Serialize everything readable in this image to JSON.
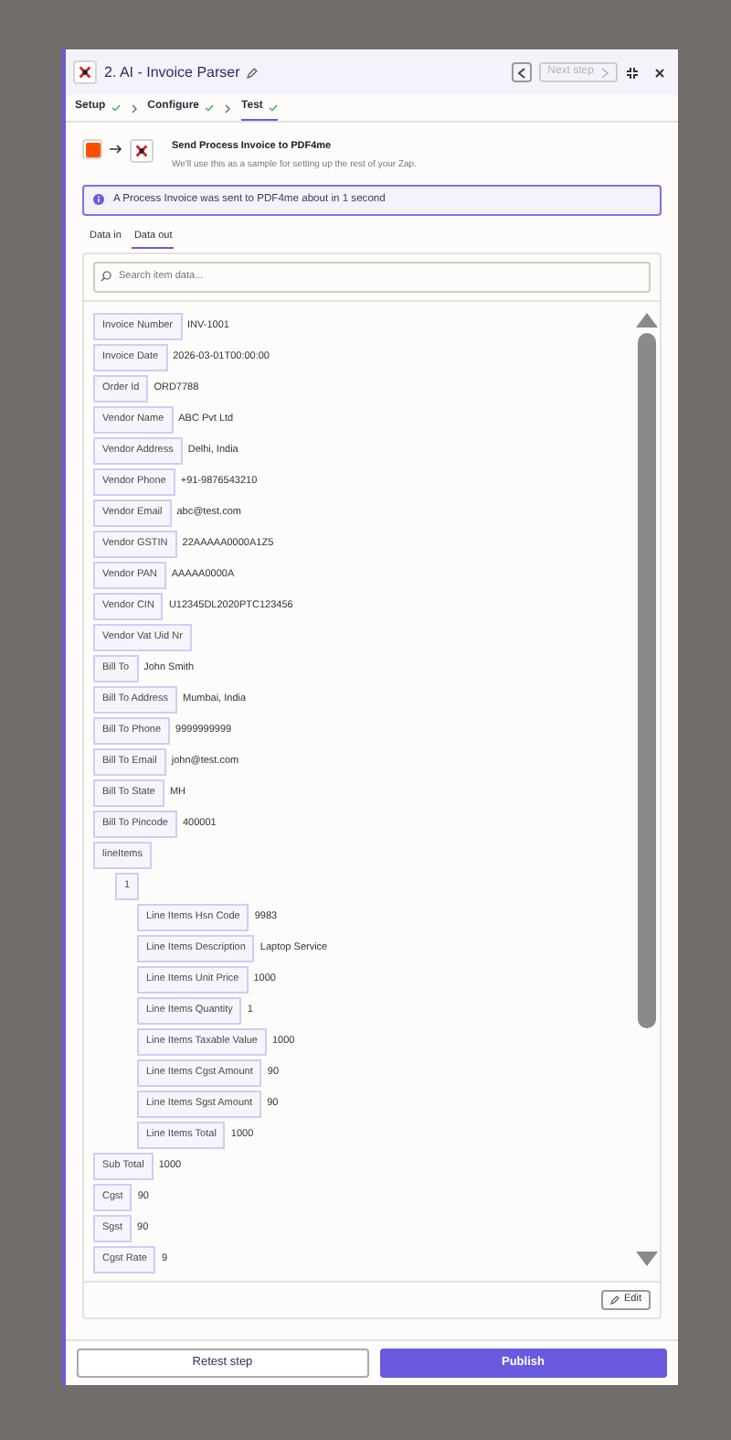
{
  "header": {
    "step_number": "2.",
    "title": "AI - Invoice Parser",
    "next_step": {
      "label": "Next step",
      "disabled": true
    }
  },
  "steps": [
    {
      "label": "Setup",
      "done": true,
      "selected": false
    },
    {
      "label": "Configure",
      "done": true,
      "selected": false
    },
    {
      "label": "Test",
      "done": true,
      "selected": true
    }
  ],
  "source": {
    "title": "Send Process Invoice to PDF4me",
    "subtitle": "We'll use this as a sample for setting up the rest of your Zap."
  },
  "info_banner": "A Process Invoice was sent to PDF4me about in 1 second",
  "data_tabs": [
    {
      "label": "Data in",
      "selected": false
    },
    {
      "label": "Data out",
      "selected": true
    }
  ],
  "search": {
    "placeholder": "Search item data..."
  },
  "fields": [
    {
      "label": "Invoice Number",
      "value": "INV-1001"
    },
    {
      "label": "Invoice Date",
      "value": "2026-03-01T00:00:00"
    },
    {
      "label": "Order Id",
      "value": "ORD7788"
    },
    {
      "label": "Vendor Name",
      "value": "ABC Pvt Ltd"
    },
    {
      "label": "Vendor Address",
      "value": "Delhi, India"
    },
    {
      "label": "Vendor Phone",
      "value": "+91-9876543210"
    },
    {
      "label": "Vendor Email",
      "value": "abc@test.com"
    },
    {
      "label": "Vendor GSTIN",
      "value": "22AAAAA0000A1Z5"
    },
    {
      "label": "Vendor PAN",
      "value": "AAAAA0000A"
    },
    {
      "label": "Vendor CIN",
      "value": "U12345DL2020PTC123456"
    },
    {
      "label": "Vendor Vat Uid Nr"
    },
    {
      "label": "Bill To",
      "value": "John Smith"
    },
    {
      "label": "Bill To Address",
      "value": "Mumbai, India"
    },
    {
      "label": "Bill To Phone",
      "value": "9999999999"
    },
    {
      "label": "Bill To Email",
      "value": "john@test.com"
    },
    {
      "label": "Bill To State",
      "value": "MH"
    },
    {
      "label": "Bill To Pincode",
      "value": "400001"
    },
    {
      "label": "lineItems",
      "children": [
        {
          "label": "1",
          "children": [
            {
              "label": "Line Items Hsn Code",
              "value": "9983"
            },
            {
              "label": "Line Items Description",
              "value": "Laptop Service"
            },
            {
              "label": "Line Items Unit Price",
              "value": "1000"
            },
            {
              "label": "Line Items Quantity",
              "value": "1"
            },
            {
              "label": "Line Items Taxable Value",
              "value": "1000"
            },
            {
              "label": "Line Items Cgst Amount",
              "value": "90"
            },
            {
              "label": "Line Items Sgst Amount",
              "value": "90"
            },
            {
              "label": "Line Items Total",
              "value": "1000"
            }
          ]
        }
      ]
    },
    {
      "label": "Sub Total",
      "value": "1000"
    },
    {
      "label": "Cgst",
      "value": "90"
    },
    {
      "label": "Sgst",
      "value": "90"
    },
    {
      "label": "Cgst Rate",
      "value": "9"
    }
  ],
  "edit_button": "Edit",
  "footer": {
    "retest": "Retest step",
    "publish": "Publish"
  }
}
